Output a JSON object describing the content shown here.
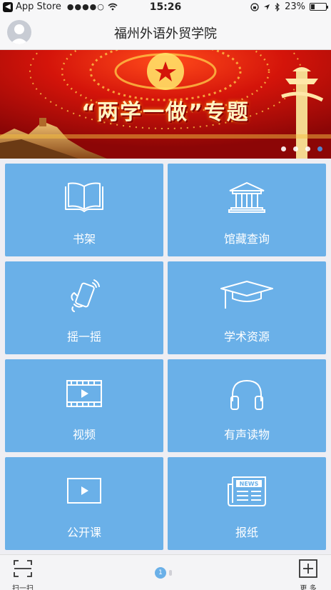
{
  "status_bar": {
    "back_app": "App Store",
    "signal": "●●●●○",
    "time": "15:26",
    "battery": "23%",
    "battery_level": 0.23
  },
  "nav": {
    "title": "福州外语外贸学院"
  },
  "banner": {
    "title": "“两学一做”专题",
    "slide_count": 4,
    "active_slide": 4
  },
  "tiles": [
    {
      "label": "书架",
      "icon": "book-icon"
    },
    {
      "label": "馆藏查询",
      "icon": "library-building-icon"
    },
    {
      "label": "摇一摇",
      "icon": "shake-phone-icon"
    },
    {
      "label": "学术资源",
      "icon": "graduation-cap-icon"
    },
    {
      "label": "视频",
      "icon": "video-icon"
    },
    {
      "label": "有声读物",
      "icon": "headphones-icon"
    },
    {
      "label": "公开课",
      "icon": "play-screen-icon"
    },
    {
      "label": "报纸",
      "icon": "newspaper-icon"
    }
  ],
  "newspaper_icon_text": "NEWS",
  "bottom_bar": {
    "scan_label": "扫一扫",
    "more_label": "更 多",
    "page_number": "1"
  }
}
